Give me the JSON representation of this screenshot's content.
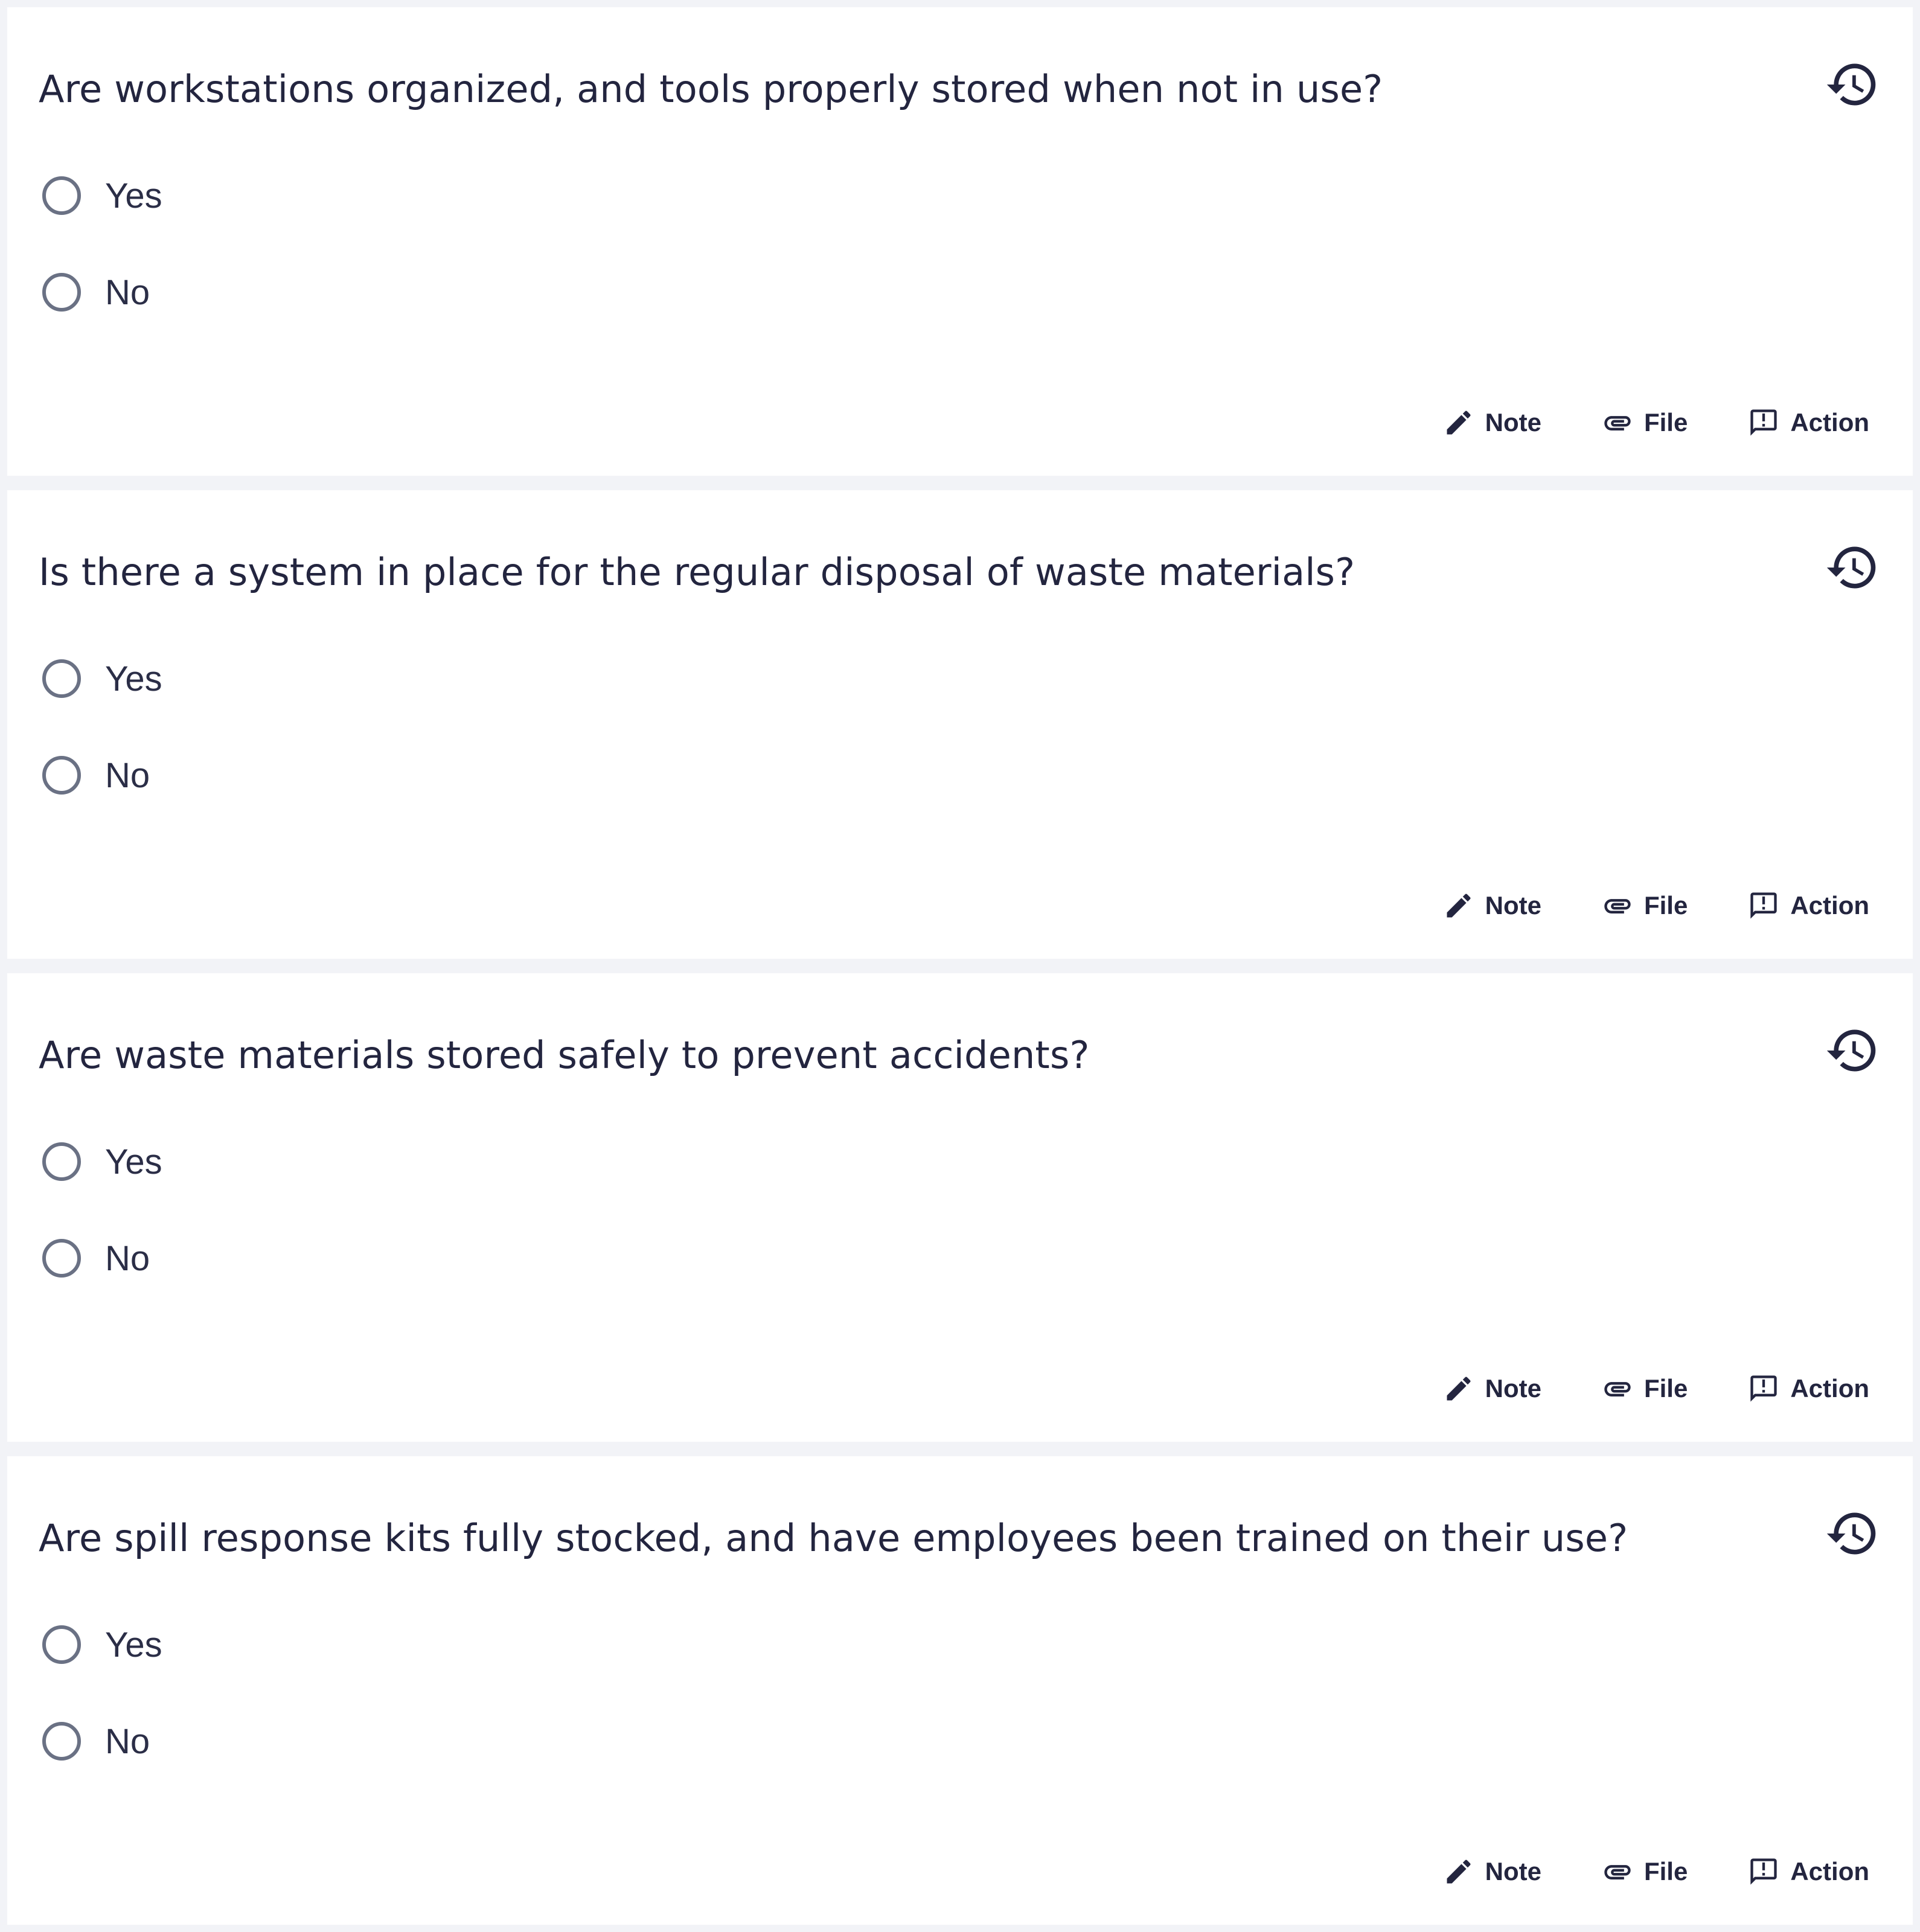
{
  "questions": [
    {
      "text": "Are workstations organized, and tools properly stored when not in use?",
      "options": [
        "Yes",
        "No"
      ],
      "actions": {
        "note": "Note",
        "file": "File",
        "action": "Action"
      }
    },
    {
      "text": "Is there a system in place for the regular disposal of waste materials?",
      "options": [
        "Yes",
        "No"
      ],
      "actions": {
        "note": "Note",
        "file": "File",
        "action": "Action"
      }
    },
    {
      "text": "Are waste materials stored safely to prevent accidents?",
      "options": [
        "Yes",
        "No"
      ],
      "actions": {
        "note": "Note",
        "file": "File",
        "action": "Action"
      }
    },
    {
      "text": "Are spill response kits fully stocked, and have employees been trained on their use?",
      "options": [
        "Yes",
        "No"
      ],
      "actions": {
        "note": "Note",
        "file": "File",
        "action": "Action"
      }
    }
  ],
  "icons": {
    "history": "history-icon",
    "note": "pencil-icon",
    "file": "paperclip-icon",
    "action": "feedback-icon"
  },
  "colors": {
    "page_background": "#f2f3f7",
    "card_background": "#ffffff",
    "text": "#23253f",
    "radio_border": "#6a7184"
  }
}
